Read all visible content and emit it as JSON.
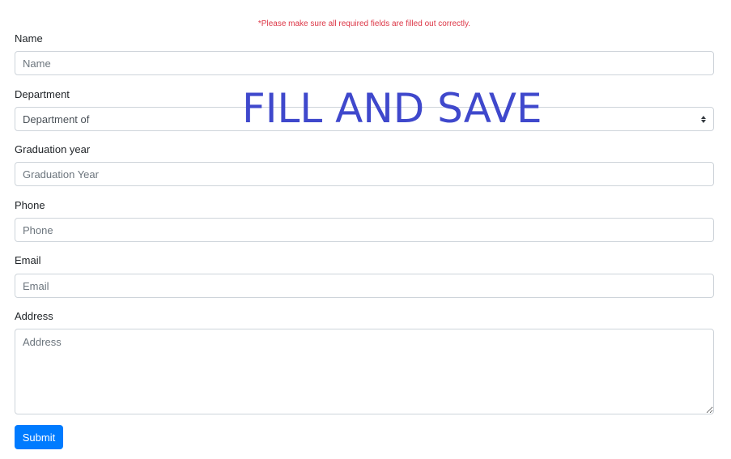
{
  "notice": "*Please make sure all required fields are filled out correctly.",
  "watermark": "FILL AND SAVE",
  "form": {
    "name": {
      "label": "Name",
      "placeholder": "Name"
    },
    "department": {
      "label": "Department",
      "value": "Department of"
    },
    "graduation_year": {
      "label": "Graduation year",
      "placeholder": "Graduation Year"
    },
    "phone": {
      "label": "Phone",
      "placeholder": "Phone"
    },
    "email": {
      "label": "Email",
      "placeholder": "Email"
    },
    "address": {
      "label": "Address",
      "placeholder": "Address"
    },
    "submit_label": "Submit"
  },
  "colors": {
    "notice": "#dc3545",
    "watermark": "#3f48cc",
    "submit_bg": "#007bff",
    "input_border": "#ced4da"
  }
}
